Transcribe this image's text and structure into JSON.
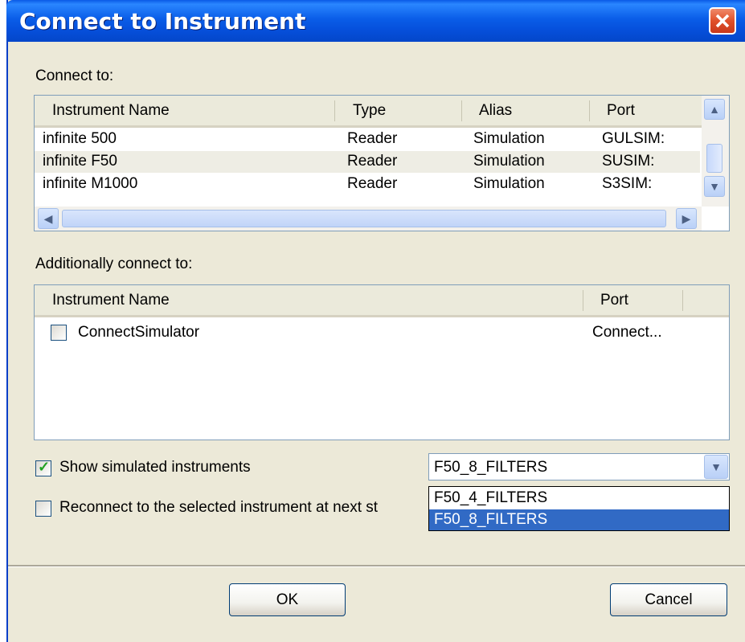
{
  "window": {
    "title": "Connect to Instrument"
  },
  "connect_to": {
    "label": "Connect to:",
    "columns": [
      "Instrument Name",
      "Type",
      "Alias",
      "Port"
    ],
    "rows": [
      [
        "infinite 500",
        "Reader",
        "Simulation",
        "GULSIM:"
      ],
      [
        "infinite F50",
        "Reader",
        "Simulation",
        "SUSIM:"
      ],
      [
        "infinite M1000",
        "Reader",
        "Simulation",
        "S3SIM:"
      ]
    ]
  },
  "additional": {
    "label": "Additionally connect to:",
    "columns": [
      "Instrument Name",
      "Port"
    ],
    "rows": [
      {
        "name": "ConnectSimulator",
        "port": "Connect...",
        "checked": false
      }
    ]
  },
  "options": {
    "show_simulated": {
      "label": "Show simulated instruments",
      "checked": true
    },
    "reconnect": {
      "label": "Reconnect to the selected instrument at next st",
      "checked": false
    }
  },
  "combo": {
    "value": "F50_8_FILTERS",
    "options": [
      "F50_4_FILTERS",
      "F50_8_FILTERS"
    ],
    "selected_index": 1
  },
  "buttons": {
    "ok": "OK",
    "cancel": "Cancel"
  },
  "colors": {
    "titlebar": "#0a5de8",
    "selection": "#316ac5",
    "dialog_bg": "#ece9d8"
  }
}
